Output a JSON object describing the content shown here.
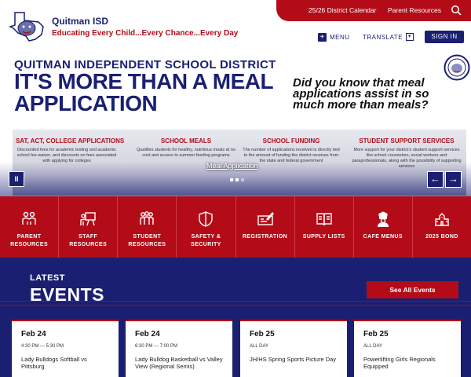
{
  "header": {
    "site_name": "Quitman ISD",
    "tagline": "Educating Every Child...Every Chance...Every Day",
    "util_links": [
      "25/26 District Calendar",
      "Parent Resources"
    ],
    "menu_label": "MENU",
    "translate_label": "TRANSLATE",
    "signin_label": "SIGN IN"
  },
  "hero": {
    "district": "QUITMAN INDEPENDENT SCHOOL DISTRICT",
    "headline": "IT'S MORE THAN A MEAL APPLICATION",
    "question": "Did you know that meal applications assist in so much more than meals?",
    "pillars": [
      {
        "title": "SAT, ACT, COLLEGE APPLICATIONS",
        "text": "Discounted fees for academic testing and academic school fee waiver, and discounts on fees associated with applying for colleges"
      },
      {
        "title": "SCHOOL MEALS",
        "text": "Qualifies students for healthy, nutritious meals at no cost and access to summer feeding programs"
      },
      {
        "title": "SCHOOL FUNDING",
        "text": "The number of applications received is directly tied to the amount of funding the district receives from the state and federal government"
      },
      {
        "title": "STUDENT SUPPORT SERVICES",
        "text": "More support for your district's student support services like school counselors, social workers and paraprofessionals, along with the possibility of supporting services"
      }
    ],
    "caption": "Meal Application",
    "pause_label": "II",
    "prev_label": "←",
    "next_label": "→"
  },
  "quicklinks": [
    {
      "label": "PARENT RESOURCES",
      "icon": "parents-icon"
    },
    {
      "label": "STAFF RESOURCES",
      "icon": "teacher-board-icon"
    },
    {
      "label": "STUDENT RESOURCES",
      "icon": "students-icon"
    },
    {
      "label": "SAFETY & SECURITY",
      "icon": "shield-icon"
    },
    {
      "label": "REGISTRATION",
      "icon": "form-pen-icon"
    },
    {
      "label": "SUPPLY LISTS",
      "icon": "open-book-icon"
    },
    {
      "label": "CAFE MENUS",
      "icon": "chef-icon"
    },
    {
      "label": "2025 BOND",
      "icon": "school-building-icon"
    }
  ],
  "events": {
    "latest": "LATEST",
    "title": "EVENTS",
    "see_all": "See All Events",
    "cards": [
      {
        "date": "Feb 24",
        "time": "4:30 PM — 5:30 PM",
        "name": "Lady Bulldogs Softball vs Pittsburg"
      },
      {
        "date": "Feb 24",
        "time": "6:30 PM — 7:00 PM",
        "name": "Lady Bulldog Basketball vs Valley View (Regional Semis)"
      },
      {
        "date": "Feb 25",
        "time": "ALL DAY",
        "name": "JH/HS Spring Sports Picture Day"
      },
      {
        "date": "Feb 25",
        "time": "ALL DAY",
        "name": "Powerlifting Girls Regionals Equipped"
      }
    ]
  },
  "colors": {
    "navy": "#1a1f71",
    "red": "#b30c18"
  }
}
